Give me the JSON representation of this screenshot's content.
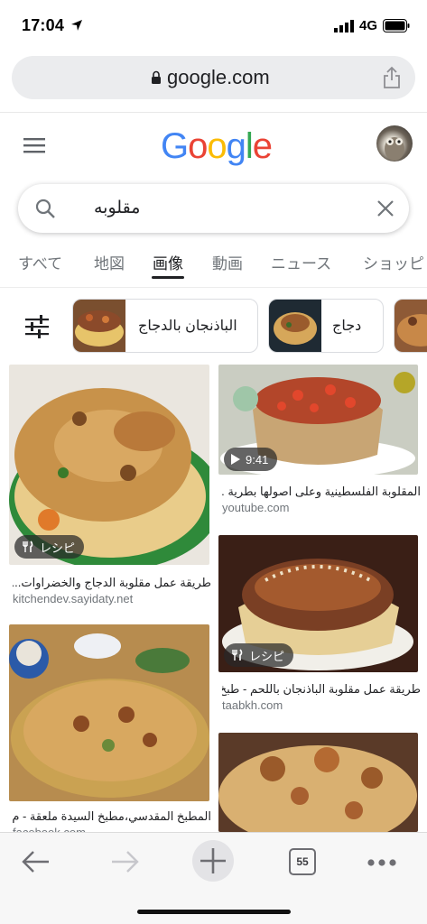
{
  "status": {
    "time": "17:04",
    "network": "4G"
  },
  "urlbar": {
    "host": "google.com"
  },
  "header": {
    "logo_letters": [
      {
        "ch": "G",
        "color": "#4285F4"
      },
      {
        "ch": "o",
        "color": "#EA4335"
      },
      {
        "ch": "o",
        "color": "#FBBC05"
      },
      {
        "ch": "g",
        "color": "#4285F4"
      },
      {
        "ch": "l",
        "color": "#34A853"
      },
      {
        "ch": "e",
        "color": "#EA4335"
      }
    ]
  },
  "search": {
    "query": "مقلوبه"
  },
  "tabs": [
    {
      "label": "すべて",
      "active": false
    },
    {
      "label": "地図",
      "active": false
    },
    {
      "label": "画像",
      "active": true
    },
    {
      "label": "動画",
      "active": false
    },
    {
      "label": "ニュース",
      "active": false
    },
    {
      "label": "ショッピ",
      "active": false
    }
  ],
  "chips": [
    {
      "label": "الباذنجان بالدجاج"
    },
    {
      "label": "دجاج"
    }
  ],
  "results": [
    {
      "title": "طريقة عمل مقلوبة الدجاج والخضراوات...",
      "source": "kitchendev.sayidaty.net",
      "badge": "レシピ"
    },
    {
      "title": "المقلوبة الفلسطينية وعلى اصولها بطرية ...",
      "source": "youtube.com",
      "badge": "9:41"
    },
    {
      "title": "طريقة عمل مقلوبة الباذنجان باللحم - طبخ",
      "source": "taabkh.com",
      "badge": "レシピ"
    },
    {
      "title": "المطبخ المقدسي،مطبخ السيدة ملعقة - م...",
      "source": "facebook.com",
      "badge": ""
    }
  ],
  "toolbar": {
    "tab_count": "55"
  },
  "colors": {
    "accent": "#4285F4",
    "text": "#202124",
    "muted": "#70757a"
  }
}
